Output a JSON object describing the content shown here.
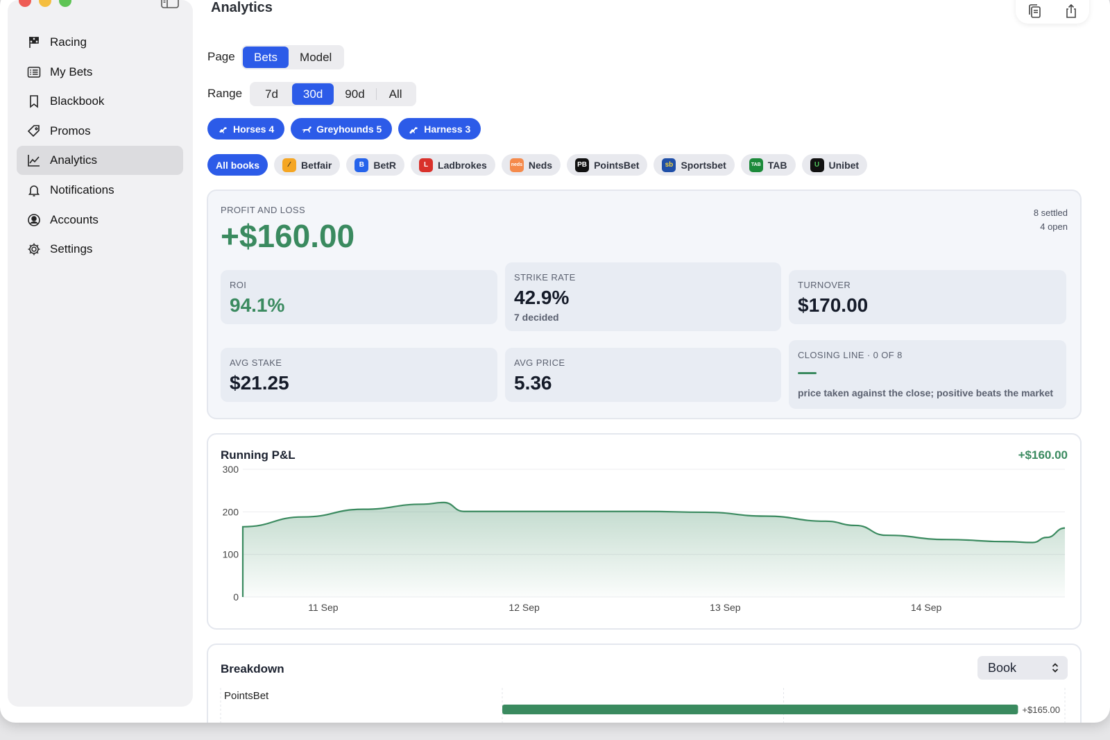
{
  "window": {
    "title": "Analytics"
  },
  "sidebar": {
    "items": [
      {
        "label": "Racing",
        "icon": "flag-icon",
        "active": false
      },
      {
        "label": "My Bets",
        "icon": "list-icon",
        "active": false
      },
      {
        "label": "Blackbook",
        "icon": "bookmark-icon",
        "active": false
      },
      {
        "label": "Promos",
        "icon": "tag-icon",
        "active": false
      },
      {
        "label": "Analytics",
        "icon": "chart-icon",
        "active": true
      },
      {
        "label": "Notifications",
        "icon": "bell-icon",
        "active": false
      },
      {
        "label": "Accounts",
        "icon": "person-circle-icon",
        "active": false
      },
      {
        "label": "Settings",
        "icon": "gear-icon",
        "active": false
      }
    ]
  },
  "filters": {
    "page_label": "Page",
    "page_options": [
      "Bets",
      "Model"
    ],
    "page_selected": "Bets",
    "range_label": "Range",
    "range_options": [
      "7d",
      "30d",
      "90d",
      "All"
    ],
    "range_selected": "30d",
    "codes": [
      {
        "label": "Horses 4",
        "icon": "horse-icon"
      },
      {
        "label": "Greyhounds 5",
        "icon": "greyhound-icon"
      },
      {
        "label": "Harness 3",
        "icon": "harness-icon"
      }
    ],
    "books": [
      {
        "label": "All books",
        "active": true
      },
      {
        "label": "Betfair",
        "color": "#f5a623",
        "glyph": "⁄"
      },
      {
        "label": "BetR",
        "color": "#2563eb",
        "glyph": "B"
      },
      {
        "label": "Ladbrokes",
        "color": "#d9312b",
        "glyph": "L"
      },
      {
        "label": "Neds",
        "color": "#f58a4b",
        "glyph": "neds"
      },
      {
        "label": "PointsBet",
        "color": "#111111",
        "glyph": "PB"
      },
      {
        "label": "Sportsbet",
        "color": "#1f4fa8",
        "glyph": "sb"
      },
      {
        "label": "TAB",
        "color": "#1c8a3a",
        "glyph": "TAB"
      },
      {
        "label": "Unibet",
        "color": "#111111",
        "glyph": "U"
      }
    ]
  },
  "pl": {
    "caption": "PROFIT AND LOSS",
    "value": "+$160.00",
    "settled": "8 settled",
    "open": "4 open",
    "stats": {
      "roi_label": "ROI",
      "roi": "94.1%",
      "strike_label": "STRIKE RATE",
      "strike": "42.9%",
      "strike_sub": "7 decided",
      "turnover_label": "TURNOVER",
      "turnover": "$170.00",
      "avg_stake_label": "AVG STAKE",
      "avg_stake": "$21.25",
      "avg_price_label": "AVG PRICE",
      "avg_price": "5.36",
      "closing_label": "CLOSING LINE · 0 OF 8",
      "closing_note": "price taken against the close; positive beats the market"
    }
  },
  "running": {
    "title": "Running P&L",
    "total": "+$160.00",
    "colors": {
      "line": "#3a8a5f"
    }
  },
  "chart_data": {
    "type": "area",
    "title": "Running P&L",
    "ylim": [
      0,
      300
    ],
    "yticks": [
      0,
      100,
      200,
      300
    ],
    "xticks": [
      "11 Sep",
      "12 Sep",
      "13 Sep",
      "14 Sep"
    ],
    "xrange": [
      10.6,
      14.69
    ],
    "x": [
      10.6,
      10.6,
      10.9,
      11.2,
      11.5,
      11.6,
      11.7,
      12.0,
      12.3,
      12.6,
      12.9,
      13.2,
      13.5,
      13.65,
      13.8,
      14.1,
      14.4,
      14.53,
      14.6,
      14.69
    ],
    "y": [
      0,
      165,
      188,
      206,
      218,
      222,
      201,
      201,
      201,
      201,
      199,
      190,
      178,
      168,
      145,
      135,
      130,
      128,
      140,
      162
    ],
    "grid": true
  },
  "breakdown": {
    "title": "Breakdown",
    "group_by": "Book",
    "rows": [
      {
        "label": "PointsBet",
        "value": "+$165.00",
        "amount": 165
      }
    ],
    "max": 180
  }
}
